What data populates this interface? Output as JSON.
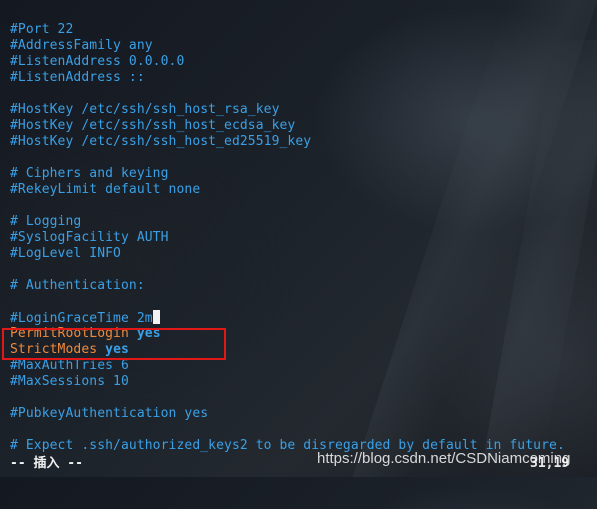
{
  "editor": {
    "lines": [
      {
        "type": "comment",
        "text": "#Port 22"
      },
      {
        "type": "comment",
        "text": "#AddressFamily any"
      },
      {
        "type": "comment",
        "text": "#ListenAddress 0.0.0.0"
      },
      {
        "type": "comment",
        "text": "#ListenAddress ::"
      },
      {
        "type": "blank",
        "text": ""
      },
      {
        "type": "comment",
        "text": "#HostKey /etc/ssh/ssh_host_rsa_key"
      },
      {
        "type": "comment",
        "text": "#HostKey /etc/ssh/ssh_host_ecdsa_key"
      },
      {
        "type": "comment",
        "text": "#HostKey /etc/ssh/ssh_host_ed25519_key"
      },
      {
        "type": "blank",
        "text": ""
      },
      {
        "type": "comment",
        "text": "# Ciphers and keying"
      },
      {
        "type": "comment",
        "text": "#RekeyLimit default none"
      },
      {
        "type": "blank",
        "text": ""
      },
      {
        "type": "comment",
        "text": "# Logging"
      },
      {
        "type": "comment",
        "text": "#SyslogFacility AUTH"
      },
      {
        "type": "comment",
        "text": "#LogLevel INFO"
      },
      {
        "type": "blank",
        "text": ""
      },
      {
        "type": "comment",
        "text": "# Authentication:"
      },
      {
        "type": "blank",
        "text": ""
      },
      {
        "type": "comment",
        "text": "#LoginGraceTime 2m"
      },
      {
        "type": "setting",
        "key": "PermitRootLogin",
        "value": "yes"
      },
      {
        "type": "setting",
        "key": "StrictModes",
        "value": "yes"
      },
      {
        "type": "comment",
        "text": "#MaxAuthTries 6"
      },
      {
        "type": "comment",
        "text": "#MaxSessions 10"
      },
      {
        "type": "blank",
        "text": ""
      },
      {
        "type": "comment",
        "text": "#PubkeyAuthentication yes"
      },
      {
        "type": "blank",
        "text": ""
      },
      {
        "type": "comment",
        "text": "# Expect .ssh/authorized_keys2 to be disregarded by default in future."
      }
    ],
    "cursor_line_index": 18
  },
  "status": {
    "mode": "-- 插入 --",
    "position": "31,19"
  },
  "watermark": "https://blog.csdn.net/CSDNiamcoming",
  "colors": {
    "comment": "#3aa0e6",
    "keyword": "#f08a3a",
    "highlight_box": "#e01818",
    "cursor": "#f2f2f2"
  }
}
